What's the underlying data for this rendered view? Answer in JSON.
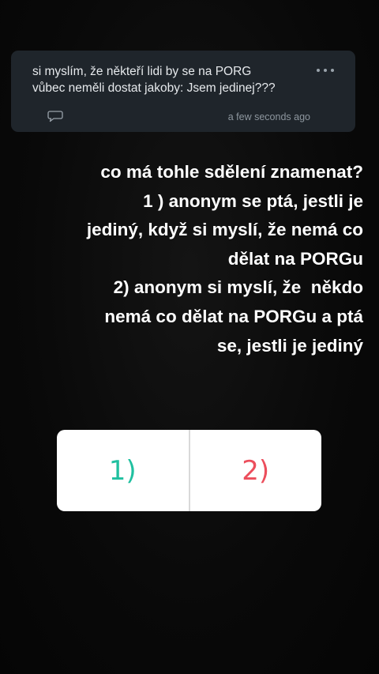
{
  "question_card": {
    "lines": [
      "si myslím, že někteří lidi by se na PORG",
      "vůbec neměli dostat jakoby: Jsem jedinej???"
    ],
    "timestamp": "a few seconds ago",
    "more_icon": "more-horizontal-icon",
    "comment_icon": "comment-icon"
  },
  "story_text": {
    "lines": [
      "co má tohle sdělení znamenat?",
      "1 ) anonym se ptá, jestli je",
      "jediný, když si myslí, že nemá co",
      "dělat na PORGu",
      "2) anonym si myslí, že  někdo",
      "nemá co dělat na PORGu a ptá",
      "se, jestli je jediný"
    ]
  },
  "poll": {
    "options": [
      {
        "label": "1)",
        "color": "#20c0a0"
      },
      {
        "label": "2)",
        "color": "#ec4e5c"
      }
    ]
  },
  "colors": {
    "background": "#0a0a0a",
    "card": "#1f252b",
    "text": "#ffffff"
  }
}
